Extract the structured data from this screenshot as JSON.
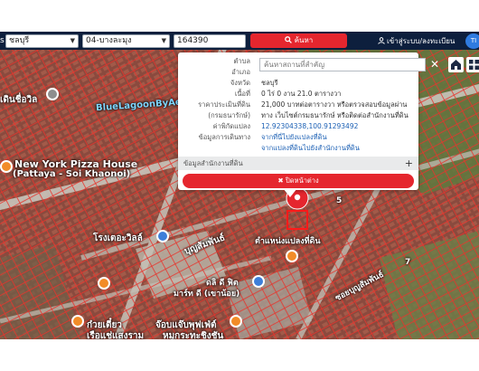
{
  "topbar": {
    "province_prefix": "s",
    "province": "ชลบุรี",
    "district": "04-บางละมุง",
    "parcel_number": "164390",
    "search_label": "ค้นหา",
    "login_label": "เข้าสู่ระบบ/ลงทะเบียน",
    "avatar_initials": "TI"
  },
  "popup": {
    "rows": [
      {
        "label": "ตำบล",
        "value": "",
        "link": false
      },
      {
        "label": "อำเภอ",
        "value": "",
        "link": false
      },
      {
        "label": "จังหวัด",
        "value": "ชลบุรี",
        "link": false
      },
      {
        "label": "เนื้อที่",
        "value": "0 ไร่ 0 งาน 21.0 ตารางวา",
        "link": false
      },
      {
        "label": "ราคาประเมินที่ดิน",
        "value": "21,000 บาทต่อตารางวา หรือตรวจสอบข้อมูลผ่าน",
        "link": false
      },
      {
        "label": "(กรมธนารักษ์)",
        "value": "ทาง เว็บไซต์กรมธนารักษ์ หรือติดต่อสำนักงานที่ดิน",
        "link": false
      },
      {
        "label": "ค่าพิกัดแปลง",
        "value": "12.92304338,100.91293492",
        "link": true
      },
      {
        "label": "ข้อมูลการเดินทาง",
        "value": "จากที่นี่ไปยังแปลงที่ดิน",
        "link": true
      },
      {
        "label": "",
        "value": "จากแปลงที่ดินไปยังสำนักงานที่ดิน",
        "link": true
      }
    ],
    "office_info_label": "ข้อมูลสำนักงานที่ดิน",
    "office_toggle": "+",
    "close_label": "✖ ปิดหน้าต่าง"
  },
  "map_controls": {
    "place_search_placeholder": "ค้นหาสถานที่สำคัญ",
    "close_symbol": "✕"
  },
  "map_labels": {
    "l1": "เดินชื่อวิล",
    "l2": "BlueLagoonByAe",
    "l3": "New York Pizza House",
    "l4": "(Pattaya - Soi Khaonoi)",
    "l5": "โรงเตอะวิลล์",
    "l6": "บุญสัมพันธ์",
    "l7": "ตำแหน่งแปลงที่ดิน",
    "l8": "ดลิ ดี ฟิต",
    "l9": "มาร์ท ดี (เขาน้อย)",
    "l10": "ซอยบุญสัมพันธ์",
    "l11": "ก๋วยเตี๋ยว",
    "l12": "เรือแช่แสงราม",
    "l13": "จ๊อบแจ๊บพุฟเฟ่ต์",
    "l14": "หมูกระทะชิงชัน",
    "l15": "5",
    "l16": "7"
  },
  "colors": {
    "topbar": "#0d1f3d",
    "accent_red": "#e5262e",
    "link_blue": "#1a5fb4",
    "parcel_line": "#e8342c"
  }
}
